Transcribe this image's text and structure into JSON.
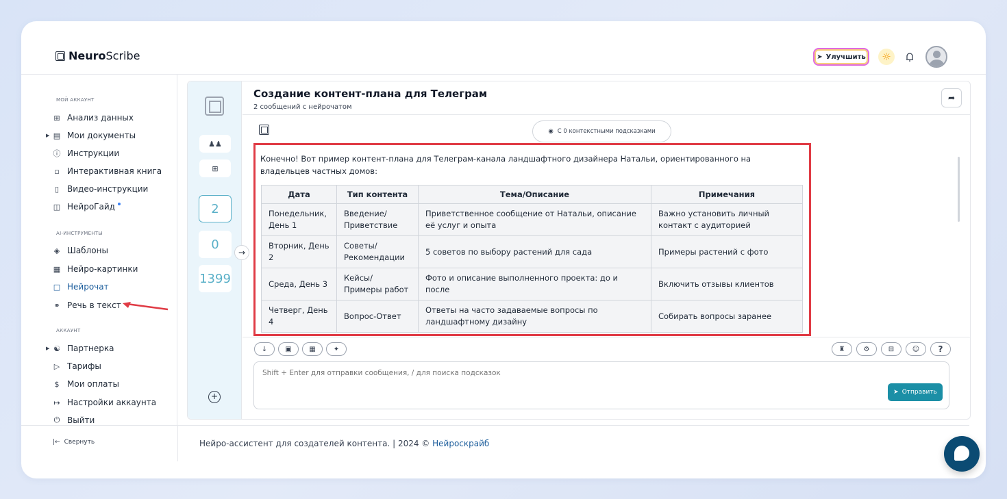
{
  "header": {
    "logo_bold": "Neuro",
    "logo_light": "Scribe",
    "upgrade_label": "Улучшить"
  },
  "sidebar": {
    "section_account": "МОЙ АККАУНТ",
    "account_items": [
      {
        "label": "Анализ данных",
        "icon": "grid-icon"
      },
      {
        "label": "Мои документы",
        "icon": "document-icon"
      },
      {
        "label": "Инструкции",
        "icon": "help-circle-icon"
      },
      {
        "label": "Интерактивная книга",
        "icon": "book-icon"
      },
      {
        "label": "Видео-инструкции",
        "icon": "video-icon"
      },
      {
        "label": "НейроГайд",
        "icon": "guide-icon"
      }
    ],
    "section_ai": "AI-ИНСТРУМЕНТЫ",
    "ai_items": [
      {
        "label": "Шаблоны",
        "icon": "layers-icon"
      },
      {
        "label": "Нейро-картинки",
        "icon": "image-icon"
      },
      {
        "label": "Нейрочат",
        "icon": "chat-icon"
      },
      {
        "label": "Речь в текст",
        "icon": "headphones-icon"
      }
    ],
    "section_acc": "АККАУНТ",
    "acc_items": [
      {
        "label": "Партнерка",
        "icon": "users-icon"
      },
      {
        "label": "Тарифы",
        "icon": "tag-icon"
      },
      {
        "label": "Мои оплаты",
        "icon": "dollar-icon"
      },
      {
        "label": "Настройки аккаунта",
        "icon": "settings-icon"
      },
      {
        "label": "Выйти",
        "icon": "power-icon"
      }
    ],
    "collapse_label": "Свернуть"
  },
  "rail": {
    "counts": [
      "2",
      "0",
      "1399"
    ]
  },
  "chat": {
    "title": "Создание контент-плана для Телеграм",
    "subtitle": "2 сообщений с нейрочатом",
    "context_pill": "С 0 контекстными подсказками",
    "intro": "Конечно! Вот пример контент-плана для Телеграм-канала ландшафтного дизайнера Натальи, ориентированного на владельцев частных домов:",
    "table": {
      "headers": [
        "Дата",
        "Тип контента",
        "Тема/Описание",
        "Примечания"
      ],
      "rows": [
        [
          "Понедельник, День 1",
          "Введение/ Приветствие",
          "Приветственное сообщение от Натальи, описание её услуг и опыта",
          "Важно установить личный контакт с аудиторией"
        ],
        [
          "Вторник, День 2",
          "Советы/ Рекомендации",
          "5 советов по выбору растений для сада",
          "Примеры растений с фото"
        ],
        [
          "Среда, День 3",
          "Кейсы/ Примеры работ",
          "Фото и описание выполненного проекта: до и после",
          "Включить отзывы клиентов"
        ],
        [
          "Четверг, День 4",
          "Вопрос-Ответ",
          "Ответы на часто задаваемые вопросы по ландшафтному дизайну",
          "Собирать вопросы заранее"
        ]
      ]
    },
    "input_placeholder": "Shift + Enter для отправки сообщения, / для поиска подсказок",
    "send_label": "Отправить",
    "help_label": "?"
  },
  "footer": {
    "text": "Нейро-ассистент для создателей контента.  | 2024 © ",
    "link": "Нейроскрайб"
  },
  "colors": {
    "accent": "#1b8fa6",
    "highlight": "#e03b45",
    "rail_bg": "#eaf5fb"
  }
}
